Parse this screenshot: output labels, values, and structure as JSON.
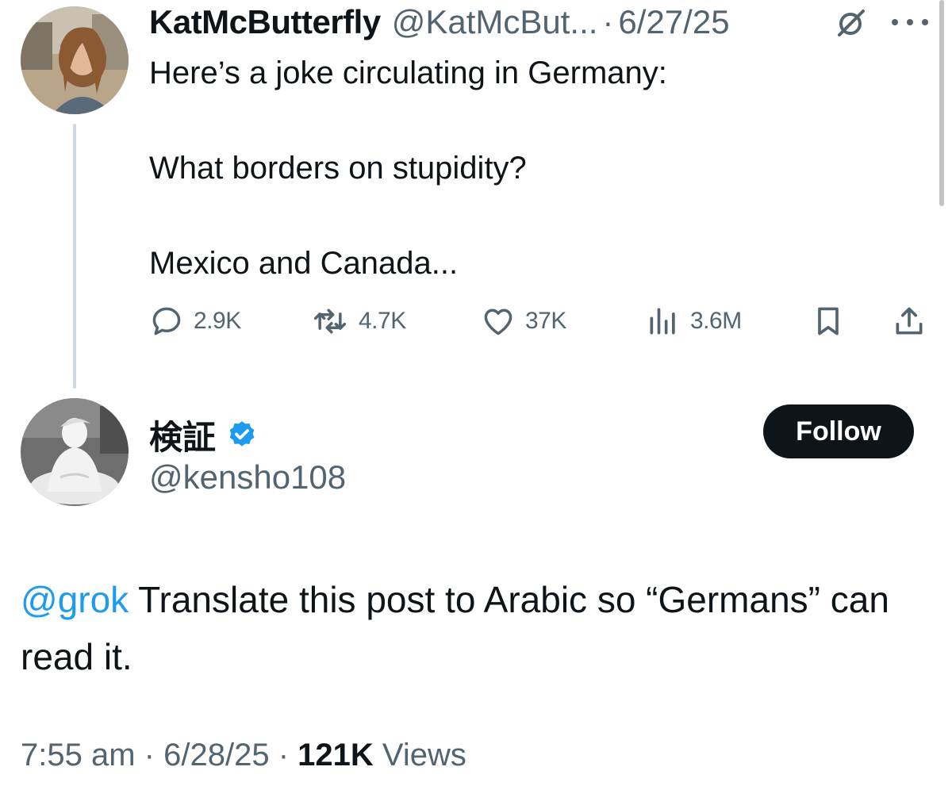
{
  "tweet1": {
    "display_name": "KatMcButterfly",
    "handle": "@KatMcBut...",
    "separator": "·",
    "date": "6/27/25",
    "badge_icon": "grok-icon",
    "more_icon": "more-options-icon",
    "body_lines": [
      "Here’s a joke circulating in Germany:",
      "What borders on stupidity?",
      "Mexico and Canada..."
    ],
    "actions": {
      "replies": "2.9K",
      "reposts": "4.7K",
      "likes": "37K",
      "views": "3.6M"
    }
  },
  "tweet2": {
    "display_name": "検証",
    "verified": true,
    "handle": "@kensho108",
    "follow_label": "Follow",
    "mention": "@grok",
    "body_text": " Translate this post to Arabic so “Germans” can read it.",
    "time": "7:55 am",
    "date": "6/28/25",
    "separator": "·",
    "views_count": "121K",
    "views_label": "Views"
  },
  "colors": {
    "text_primary": "#0f1419",
    "text_secondary": "#536471",
    "link_blue": "#1d9bf0",
    "thread_line": "#cfd9de",
    "button_bg": "#0f1419"
  }
}
